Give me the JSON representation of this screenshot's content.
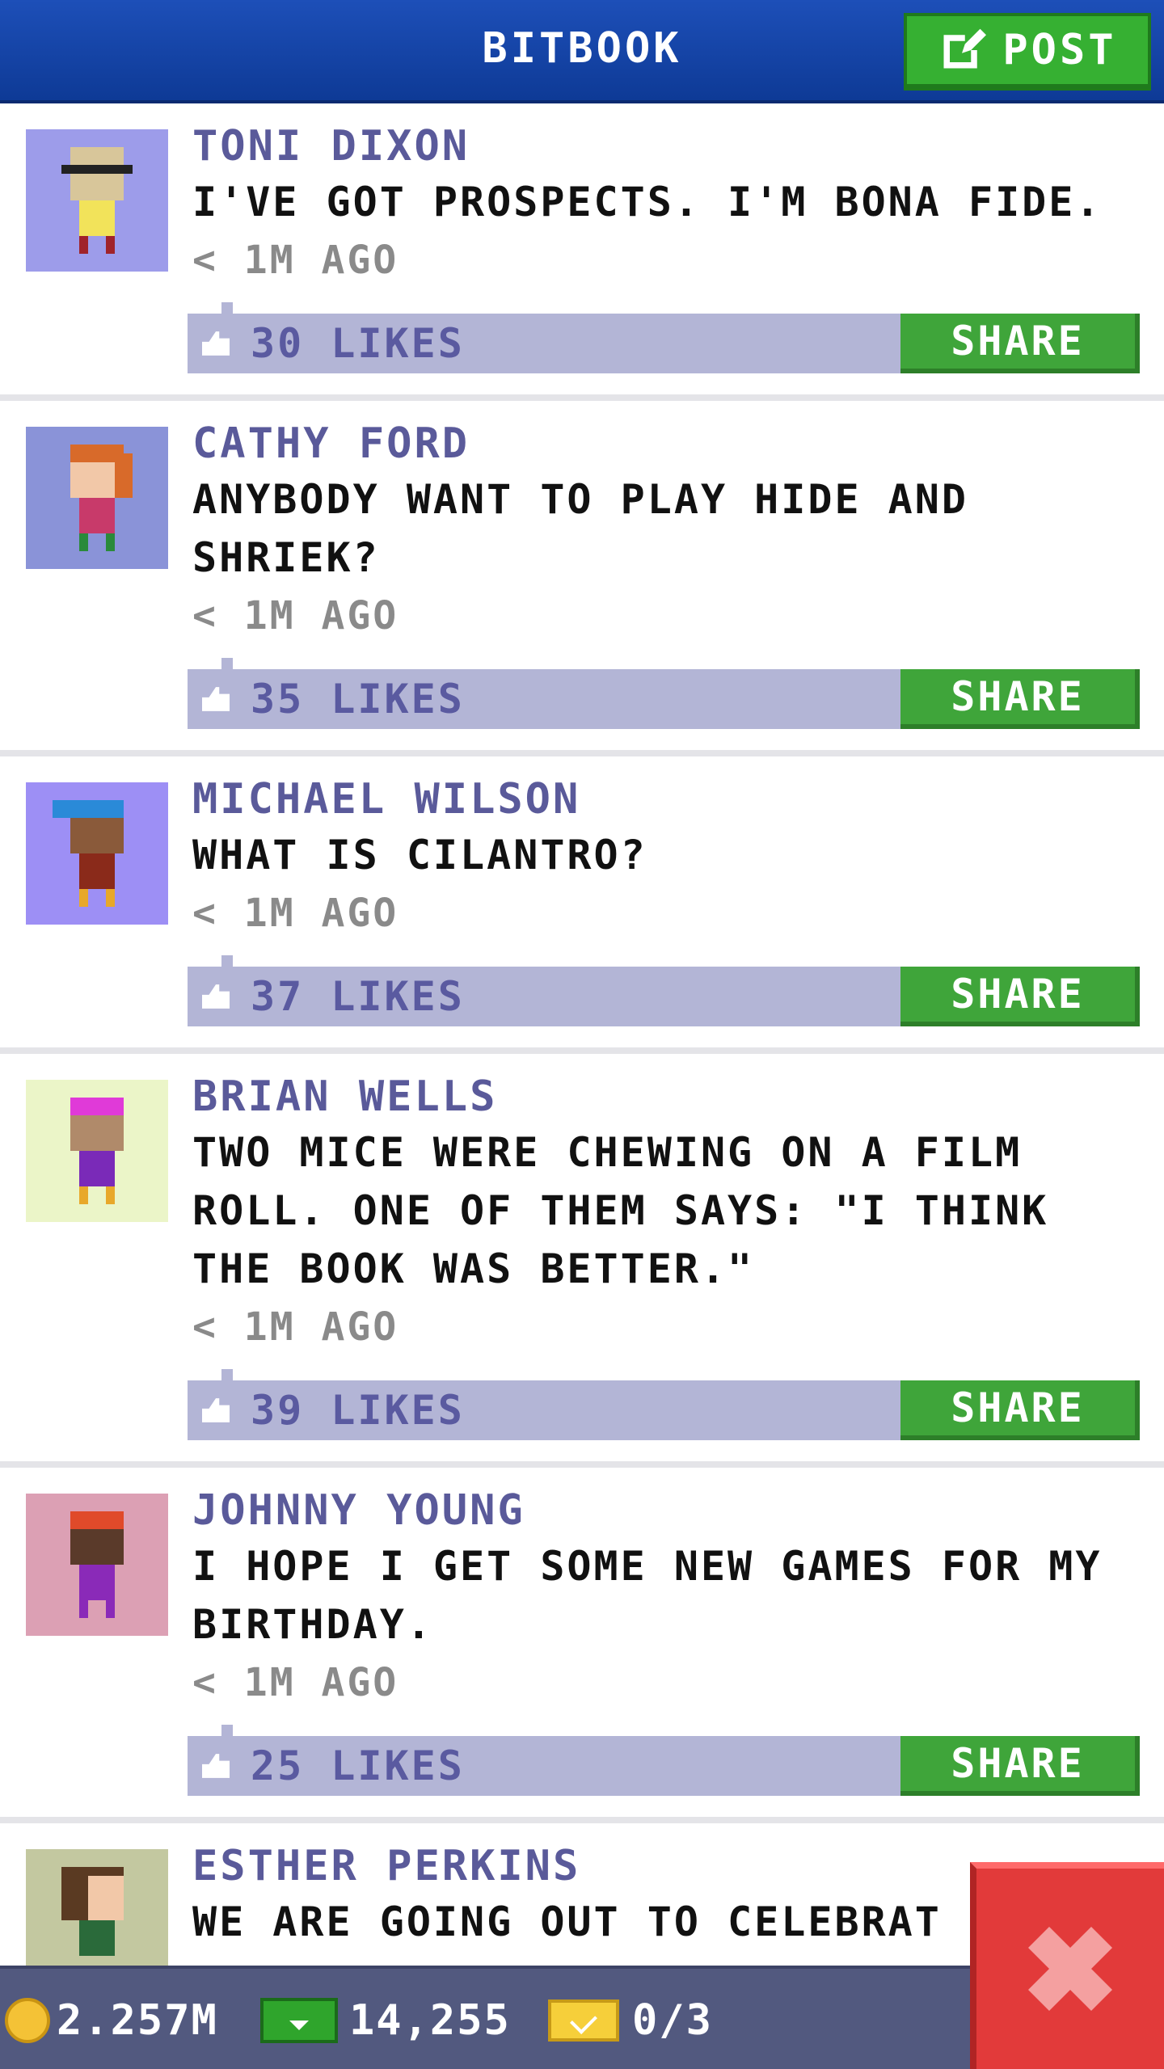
{
  "header": {
    "title": "BITBOOK",
    "post_label": "POST"
  },
  "feed": [
    {
      "author": "TONI DIXON",
      "message": "I'VE GOT PROSPECTS. I'M BONA FIDE.",
      "time": "< 1M AGO",
      "likes": "30 LIKES",
      "share_label": "SHARE",
      "avatar_bg": "#9d9cea"
    },
    {
      "author": "CATHY FORD",
      "message": "ANYBODY WANT TO PLAY HIDE AND SHRIEK?",
      "time": "< 1M AGO",
      "likes": "35 LIKES",
      "share_label": "SHARE",
      "avatar_bg": "#8a93d8"
    },
    {
      "author": "MICHAEL WILSON",
      "message": "WHAT IS CILANTRO?",
      "time": "< 1M AGO",
      "likes": "37 LIKES",
      "share_label": "SHARE",
      "avatar_bg": "#9d8ff5"
    },
    {
      "author": "BRIAN WELLS",
      "message": "TWO MICE WERE CHEWING ON A FILM ROLL. ONE OF THEM SAYS: \"I THINK THE BOOK WAS BETTER.\"",
      "time": "< 1M AGO",
      "likes": "39 LIKES",
      "share_label": "SHARE",
      "avatar_bg": "#ebf5c8"
    },
    {
      "author": "JOHNNY YOUNG",
      "message": "I HOPE I GET SOME NEW GAMES FOR MY BIRTHDAY.",
      "time": "< 1M AGO",
      "likes": "25 LIKES",
      "share_label": "SHARE",
      "avatar_bg": "#dca0b4"
    },
    {
      "author": "ESTHER PERKINS",
      "message": "WE ARE GOING OUT TO CELEBRAT",
      "time": "",
      "likes": "",
      "share_label": "",
      "avatar_bg": "#c3c8a0"
    }
  ],
  "status": {
    "coins": "2.257M",
    "bux": "14,255",
    "tickets": "0/3"
  },
  "colors": {
    "header": "#1d4fb8",
    "accent_green": "#36b032",
    "like_bar": "#b3b5d6",
    "close_red": "#e23a3a"
  }
}
